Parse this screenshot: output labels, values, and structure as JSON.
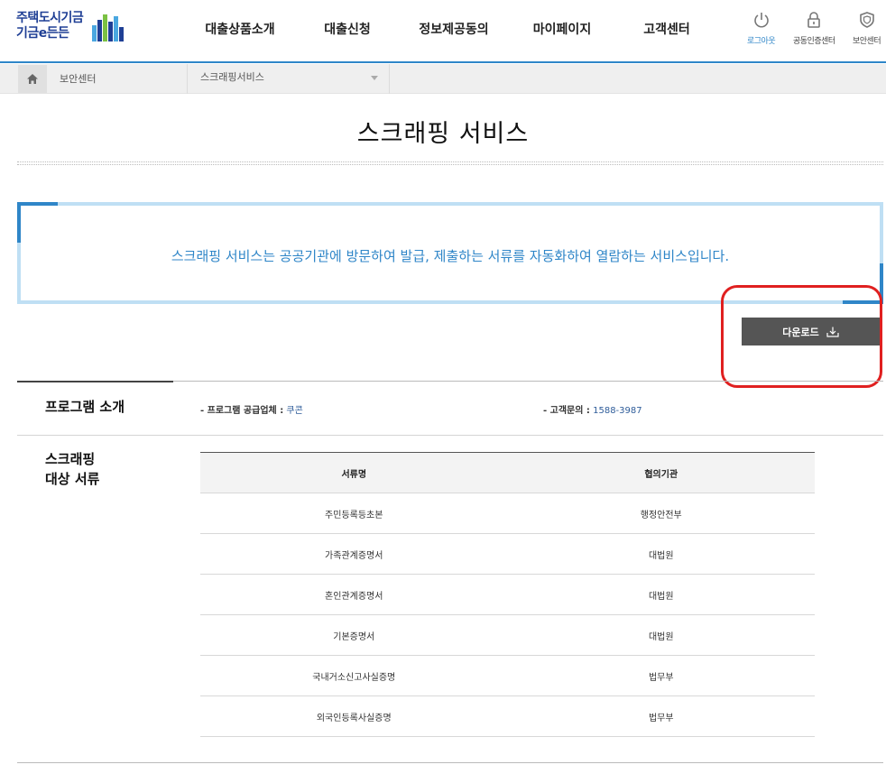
{
  "header": {
    "logo_line1": "주택도시기금",
    "logo_line2": "기금e든든",
    "nav": [
      "대출상품소개",
      "대출신청",
      "정보제공동의",
      "마이페이지",
      "고객센터"
    ],
    "utils": [
      {
        "label": "로그아웃",
        "icon": "power-icon",
        "active": true
      },
      {
        "label": "공동인증센터",
        "icon": "lock-icon",
        "active": false
      },
      {
        "label": "보안센터",
        "icon": "shield-icon",
        "active": false
      }
    ]
  },
  "breadcrumb": {
    "home_icon": "home-icon",
    "level1": "보안센터",
    "level2": "스크래핑서비스"
  },
  "page": {
    "title": "스크래핑 서비스",
    "notice": "스크래핑 서비스는 공공기관에 방문하여 발급, 제출하는 서류를 자동화하여 열람하는 서비스입니다.",
    "download_label": "다운로드"
  },
  "program": {
    "section_title": "프로그램 소개",
    "vendor_label": "- 프로그램 공급업체 :",
    "vendor_value": "쿠콘",
    "contact_label": "- 고객문의 :",
    "contact_value": "1588-3987"
  },
  "documents": {
    "section_title_line1": "스크래핑",
    "section_title_line2": "대상 서류",
    "columns": [
      "서류명",
      "협의기관"
    ],
    "rows": [
      [
        "주민등록등초본",
        "행정안전부"
      ],
      [
        "가족관계증명서",
        "대법원"
      ],
      [
        "혼인관계증명서",
        "대법원"
      ],
      [
        "기본증명서",
        "대법원"
      ],
      [
        "국내거소신고사실증명",
        "법무부"
      ],
      [
        "외국인등록사실증명",
        "법무부"
      ]
    ]
  },
  "colors": {
    "accent": "#2f86c8",
    "brand": "#1f3f95",
    "highlight": "#e02020",
    "button": "#555555"
  }
}
